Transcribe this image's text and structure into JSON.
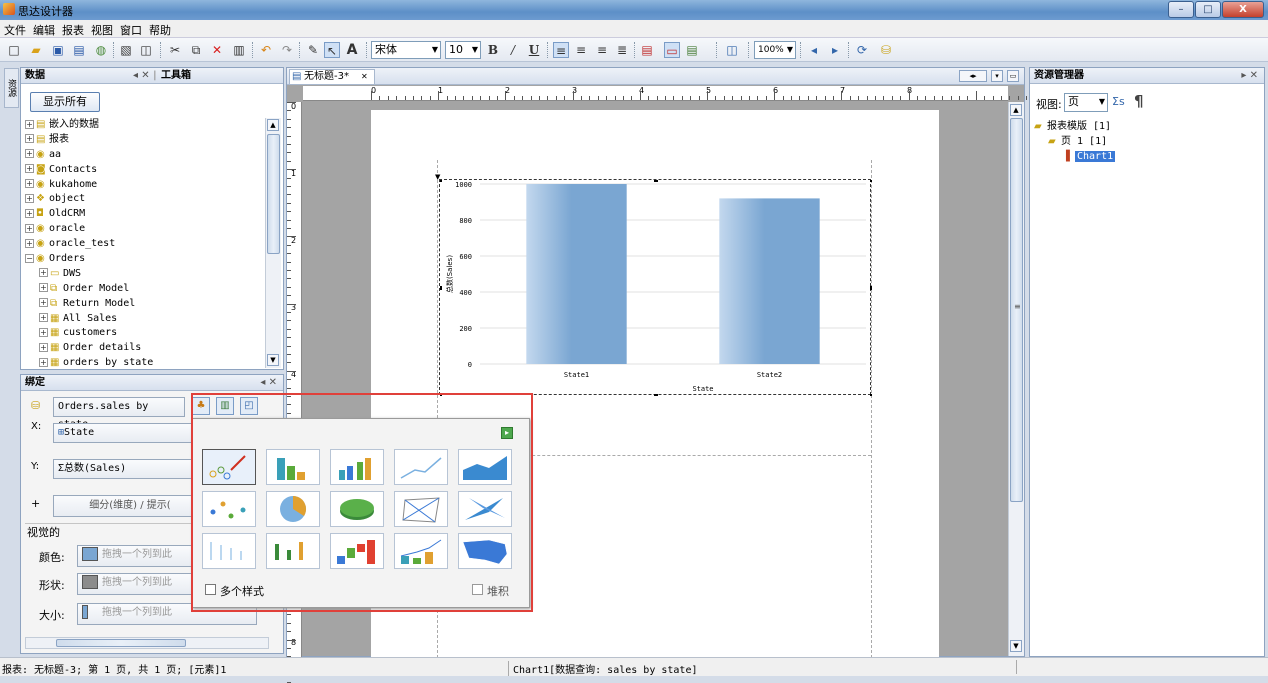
{
  "window": {
    "title": "思达设计器",
    "min": "–",
    "max": "□",
    "close": "X"
  },
  "menu": [
    "文件",
    "编辑",
    "报表",
    "视图",
    "窗口",
    "帮助"
  ],
  "toolbar": {
    "font": "宋体",
    "size": "10",
    "zoom": "100%",
    "bold": "B",
    "italic": "/",
    "underline": "U",
    "text_tool": "A"
  },
  "data_panel": {
    "title": "数据",
    "toolbox_tab": "工具箱",
    "show_all": "显示所有",
    "vertical_tab": "资源",
    "tree": [
      {
        "label": "嵌入的数据",
        "indent": 0,
        "pm": "+",
        "icon": "▤"
      },
      {
        "label": "报表",
        "indent": 0,
        "pm": "+",
        "icon": "▤"
      },
      {
        "label": "aa",
        "indent": 0,
        "pm": "+",
        "icon": "◉"
      },
      {
        "label": "Contacts",
        "indent": 0,
        "pm": "+",
        "icon": "◙"
      },
      {
        "label": "kukahome",
        "indent": 0,
        "pm": "+",
        "icon": "◉"
      },
      {
        "label": "object",
        "indent": 0,
        "pm": "+",
        "icon": "❖"
      },
      {
        "label": "OldCRM",
        "indent": 0,
        "pm": "+",
        "icon": "◘"
      },
      {
        "label": "oracle",
        "indent": 0,
        "pm": "+",
        "icon": "◉"
      },
      {
        "label": "oracle_test",
        "indent": 0,
        "pm": "+",
        "icon": "◉"
      },
      {
        "label": "Orders",
        "indent": 0,
        "pm": "−",
        "icon": "◉"
      },
      {
        "label": "DWS",
        "indent": 1,
        "pm": "+",
        "icon": "▭"
      },
      {
        "label": "Order Model",
        "indent": 1,
        "pm": "+",
        "icon": "⧉"
      },
      {
        "label": "Return Model",
        "indent": 1,
        "pm": "+",
        "icon": "⧉"
      },
      {
        "label": "All Sales",
        "indent": 1,
        "pm": "+",
        "icon": "▦"
      },
      {
        "label": "customers",
        "indent": 1,
        "pm": "+",
        "icon": "▦"
      },
      {
        "label": "Order details",
        "indent": 1,
        "pm": "+",
        "icon": "▦"
      },
      {
        "label": "orders by state",
        "indent": 1,
        "pm": "+",
        "icon": "▦"
      }
    ]
  },
  "binding_panel": {
    "title": "绑定",
    "source": "Orders.sales by state",
    "x_label": "X:",
    "x_value": "State",
    "y_label": "Y:",
    "y_value": "总数(Sales)",
    "plus": "+",
    "detail": "细分(维度) / 提示(",
    "visual_label": "视觉的",
    "color_label": "颜色:",
    "shape_label": "形状:",
    "size_label": "大小:",
    "drop_hint": "拖拽一个列到此"
  },
  "chart_popup": {
    "multi_style": "多个样式",
    "stack": "堆积"
  },
  "editor": {
    "tab": "无标题-3*",
    "ruler_h": [
      "0",
      "1",
      "2",
      "3",
      "4",
      "5",
      "6",
      "7",
      "8"
    ],
    "ruler_v": [
      "0",
      "1",
      "2",
      "3",
      "4",
      "5",
      "6",
      "7",
      "8"
    ]
  },
  "chart_data": {
    "type": "bar",
    "categories": [
      "State1",
      "State2"
    ],
    "values": [
      1000,
      920
    ],
    "ylim": [
      0,
      1000
    ],
    "yticks": [
      "0",
      "200",
      "400",
      "600",
      "800",
      "1000"
    ],
    "xlabel": "State",
    "ylabel": "总数(Sales)",
    "bar_color": "#7aa6d2"
  },
  "resource_panel": {
    "title": "资源管理器",
    "view_label": "视图:",
    "view_value": "页",
    "pilcrow": "¶",
    "filter": "Σs",
    "tree": [
      {
        "label": "报表模版 [1]",
        "indent": 0
      },
      {
        "label": "页 1  [1]",
        "indent": 1
      },
      {
        "label": "Chart1",
        "indent": 2
      }
    ]
  },
  "status": {
    "left": "报表: 无标题-3; 第 1 页, 共 1 页; [元素]1",
    "middle": "Chart1[数据查询: sales by state]"
  }
}
